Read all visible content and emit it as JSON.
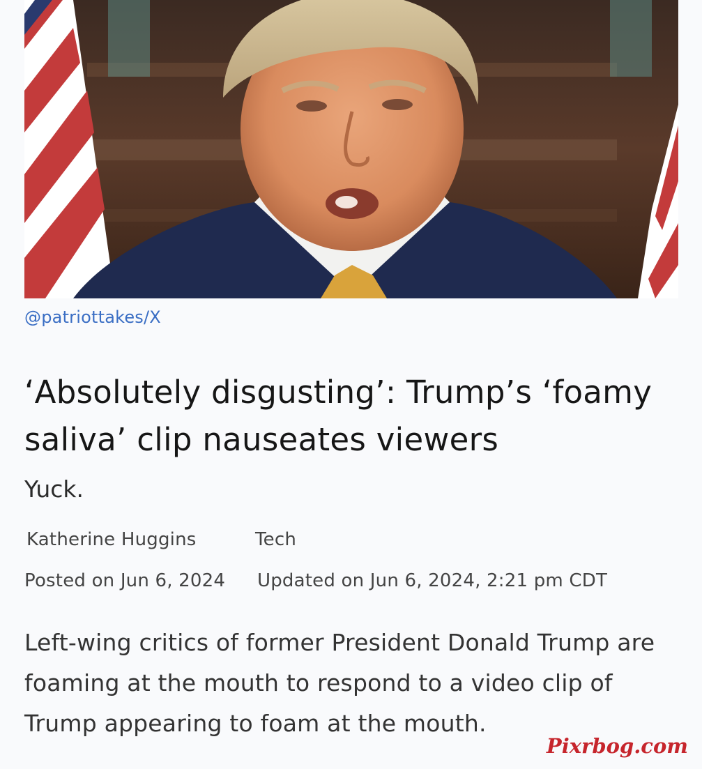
{
  "hero": {
    "image_subject": "news photo of Donald Trump speaking in front of American flags"
  },
  "credit": "@patriottakes/X",
  "article": {
    "headline": "‘Absolutely disgusting’: Trump’s ‘foamy saliva’ clip nauseates viewers",
    "subhead": "Yuck.",
    "author": "Katherine Huggins",
    "category": "Tech",
    "posted": "Posted on Jun 6, 2024",
    "updated": "Updated on Jun 6, 2024, 2:21 pm CDT",
    "body": "Left-wing critics of former President Donald Trump are foaming at the mouth to respond to a video clip of Trump appearing to foam at the mouth."
  },
  "watermark": "Pixrbog.com",
  "colors": {
    "link": "#3a6ec4",
    "watermark": "#c6252c",
    "background": "#f9fafc"
  }
}
